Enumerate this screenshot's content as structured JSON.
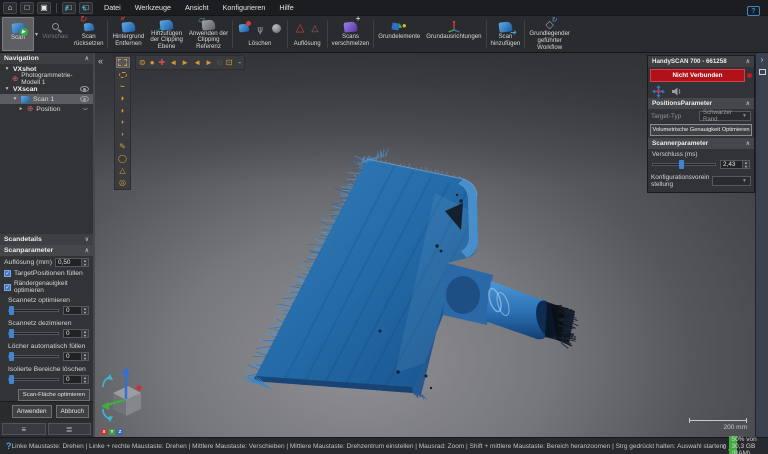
{
  "window": {
    "menus": [
      "Datei",
      "Werkzeuge",
      "Ansicht",
      "Konfigurieren",
      "Hilfe"
    ],
    "titlebar_icon_names": [
      "home-icon",
      "new-session-icon",
      "box-icon",
      "open-session-icon",
      "save-session-icon"
    ],
    "help_icon_name": "help-feedback-icon"
  },
  "ribbon": {
    "scan_label": "Scan",
    "vorschau_label": "Vorschau",
    "ruecksetzen_label": "Scan\nrücksetzen",
    "hintergrund_label": "Hintergrund\nEntfernen",
    "clipping_ebene_label": "Hinzufügen\nder Clipping\nEbene",
    "clipping_referenz_label": "Anwenden der\nClipping\nReferenz",
    "loeschen_label": "Löschen",
    "aufloesung_label": "Auflösung",
    "verschmelzen_label": "Scans\nverschmelzen",
    "grundelemente_label": "Grundelemente",
    "grundausrichtungen_label": "Grundausrichtungen",
    "scan_hinzufuegen_label": "Scan\nhinzufügen",
    "workflow_label": "Grundlegender\ngeführter\nWorkflow",
    "icon_names": [
      "scan-play-icon",
      "preview-magnifier-icon",
      "reset-scan-icon",
      "remove-background-icon",
      "add-clipping-plane-icon",
      "apply-clipping-reference-icon",
      "delete-brush-icon",
      "delete-branch-icon",
      "delete-sphere-icon",
      "resolution-triangle-icon",
      "resolution-triangle-small-icon",
      "merge-scans-icon",
      "primitives-icon",
      "alignments-axis-icon",
      "add-scan-icon",
      "guided-workflow-icon"
    ]
  },
  "navigation": {
    "title": "Navigation",
    "vxshot": "VXshot",
    "photogrammetrie": "Photogrammetrie-Modell 1",
    "vxscan": "VXscan",
    "scan1": "Scan 1",
    "position": "Position"
  },
  "scandetails": {
    "title": "Scandetails",
    "scanparameter_title": "Scanparameter",
    "aufloesung_label": "Auflösung (mm)",
    "aufloesung_value": "0,50",
    "checkbox1": "TargetPositionen füllen",
    "checkbox2": "Rändergenauigkeit optimieren",
    "check_glyph": "✓",
    "slider1_label": "Scannetz optimieren",
    "slider1_value": "0",
    "slider2_label": "Scannetz dezimieren",
    "slider2_value": "0",
    "slider3_label": "Löcher automatisch füllen",
    "slider3_value": "0",
    "slider4_label": "Isolierte Bereiche löschen",
    "slider4_value": "0",
    "optimize_button": "Scan-Fläche optimieren",
    "apply_button": "Anwenden",
    "cancel_button": "Abbruch"
  },
  "scanner_panel": {
    "title": "HandySCAN 700 - 661258",
    "connection_status": "Nicht Verbunden",
    "icon_names": [
      "targeting-move-icon",
      "speaker-icon",
      "connection-led-icon"
    ],
    "positions_title": "PositionsParameter",
    "target_typ_label": "Target-Typ",
    "target_typ_value": "Schwarzer Rand",
    "volumetric_button": "Volumetrische Genauigkeit Optimieren",
    "scanner_title": "Scannerparameter",
    "verschluss_label": "Verschluss (ms)",
    "verschluss_value": "2,43",
    "konfig_label": "Konfigurationsvorein\nstellung"
  },
  "viewport": {
    "scale_label": "200 mm",
    "axis_x": "X",
    "axis_y": "Y",
    "axis_z": "Z",
    "toolbar_icon_names": [
      "collapse-chevron-icon",
      "rect-select-icon",
      "ellipse-select-icon",
      "circle-brush-icon",
      "move-cross-icon",
      "rotate-left-icon",
      "rotate-right-icon",
      "flip-left-icon",
      "flip-right-icon",
      "dotted-circle-icon",
      "dotted-square-icon",
      "more-icon",
      "lasso-icon",
      "freecurve-icon",
      "halfdisc-icon",
      "pencil-icon",
      "circle-icon",
      "triangle-icon",
      "drop-icon"
    ]
  },
  "statusbar": {
    "hints": "Linke Maustaste: Drehen  |  Linke + rechte Maustaste: Drehen  |  Mittlere Maustaste: Verschieben  |  Mittlere Maustaste: Drehzentrum einstellen  |  Mausrad: Zoom  |  Shift + mittlere Maustaste: Bereich heranzoomen  |  Strg gedrückt halten: Auswahl starten",
    "help_glyph": "?",
    "ram_text": "50% von 30,3 GB (RAM)"
  },
  "colors": {
    "accent_orange": "#d69a35",
    "scan_blue": "#2f7fc4",
    "alert_red": "#b11219",
    "ram_green": "#3fae3f",
    "selection_gray": "#5b5d61"
  }
}
